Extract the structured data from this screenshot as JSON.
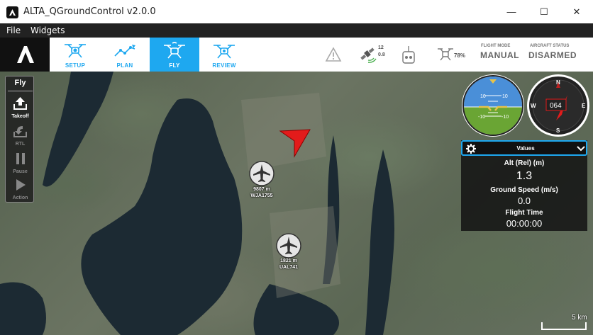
{
  "window": {
    "title": "ALTA_QGroundControl v2.0.0",
    "minimize_glyph": "—",
    "maximize_glyph": "☐",
    "close_glyph": "✕"
  },
  "menu": {
    "items": [
      {
        "label": "File"
      },
      {
        "label": "Widgets"
      }
    ]
  },
  "toolbar": {
    "tabs": [
      {
        "label": "SETUP",
        "icon": "setup-drone-icon",
        "active": false
      },
      {
        "label": "PLAN",
        "icon": "plan-path-icon",
        "active": false
      },
      {
        "label": "FLY",
        "icon": "fly-drone-icon",
        "active": true
      },
      {
        "label": "REVIEW",
        "icon": "review-drone-icon",
        "active": false
      }
    ],
    "gps": {
      "sat_count": "12",
      "hdop": "0.8"
    },
    "battery": {
      "percent": "78%"
    },
    "flight_mode": {
      "label": "FLIGHT MODE",
      "value": "MANUAL"
    },
    "aircraft_status": {
      "label": "AIRCRAFT STATUS",
      "value": "DISARMED"
    },
    "accent_color": "#1ea8f0"
  },
  "fly_tools": {
    "title": "Fly",
    "buttons": [
      {
        "label": "Takeoff",
        "enabled": true
      },
      {
        "label": "RTL",
        "enabled": false
      },
      {
        "label": "Pause",
        "enabled": false
      },
      {
        "label": "Action",
        "enabled": false
      }
    ]
  },
  "attitude": {
    "pitch_labels": [
      "10",
      "10",
      "-10",
      "-10"
    ]
  },
  "compass": {
    "heading": "064",
    "cardinals": {
      "n": "N",
      "e": "E",
      "s": "S",
      "w": "W"
    }
  },
  "values_panel": {
    "title": "Values",
    "rows": [
      {
        "label": "Alt (Rel) (m)",
        "value": "1.3"
      },
      {
        "label": "Ground Speed (m/s)",
        "value": "0.0"
      },
      {
        "label": "Flight Time",
        "value": "00:00:00"
      }
    ]
  },
  "map": {
    "aircraft": [
      {
        "altitude": "9807 m",
        "callsign": "WJA1755"
      },
      {
        "altitude": "1821 m",
        "callsign": "UAL741"
      }
    ],
    "scale_label": "5 km"
  }
}
